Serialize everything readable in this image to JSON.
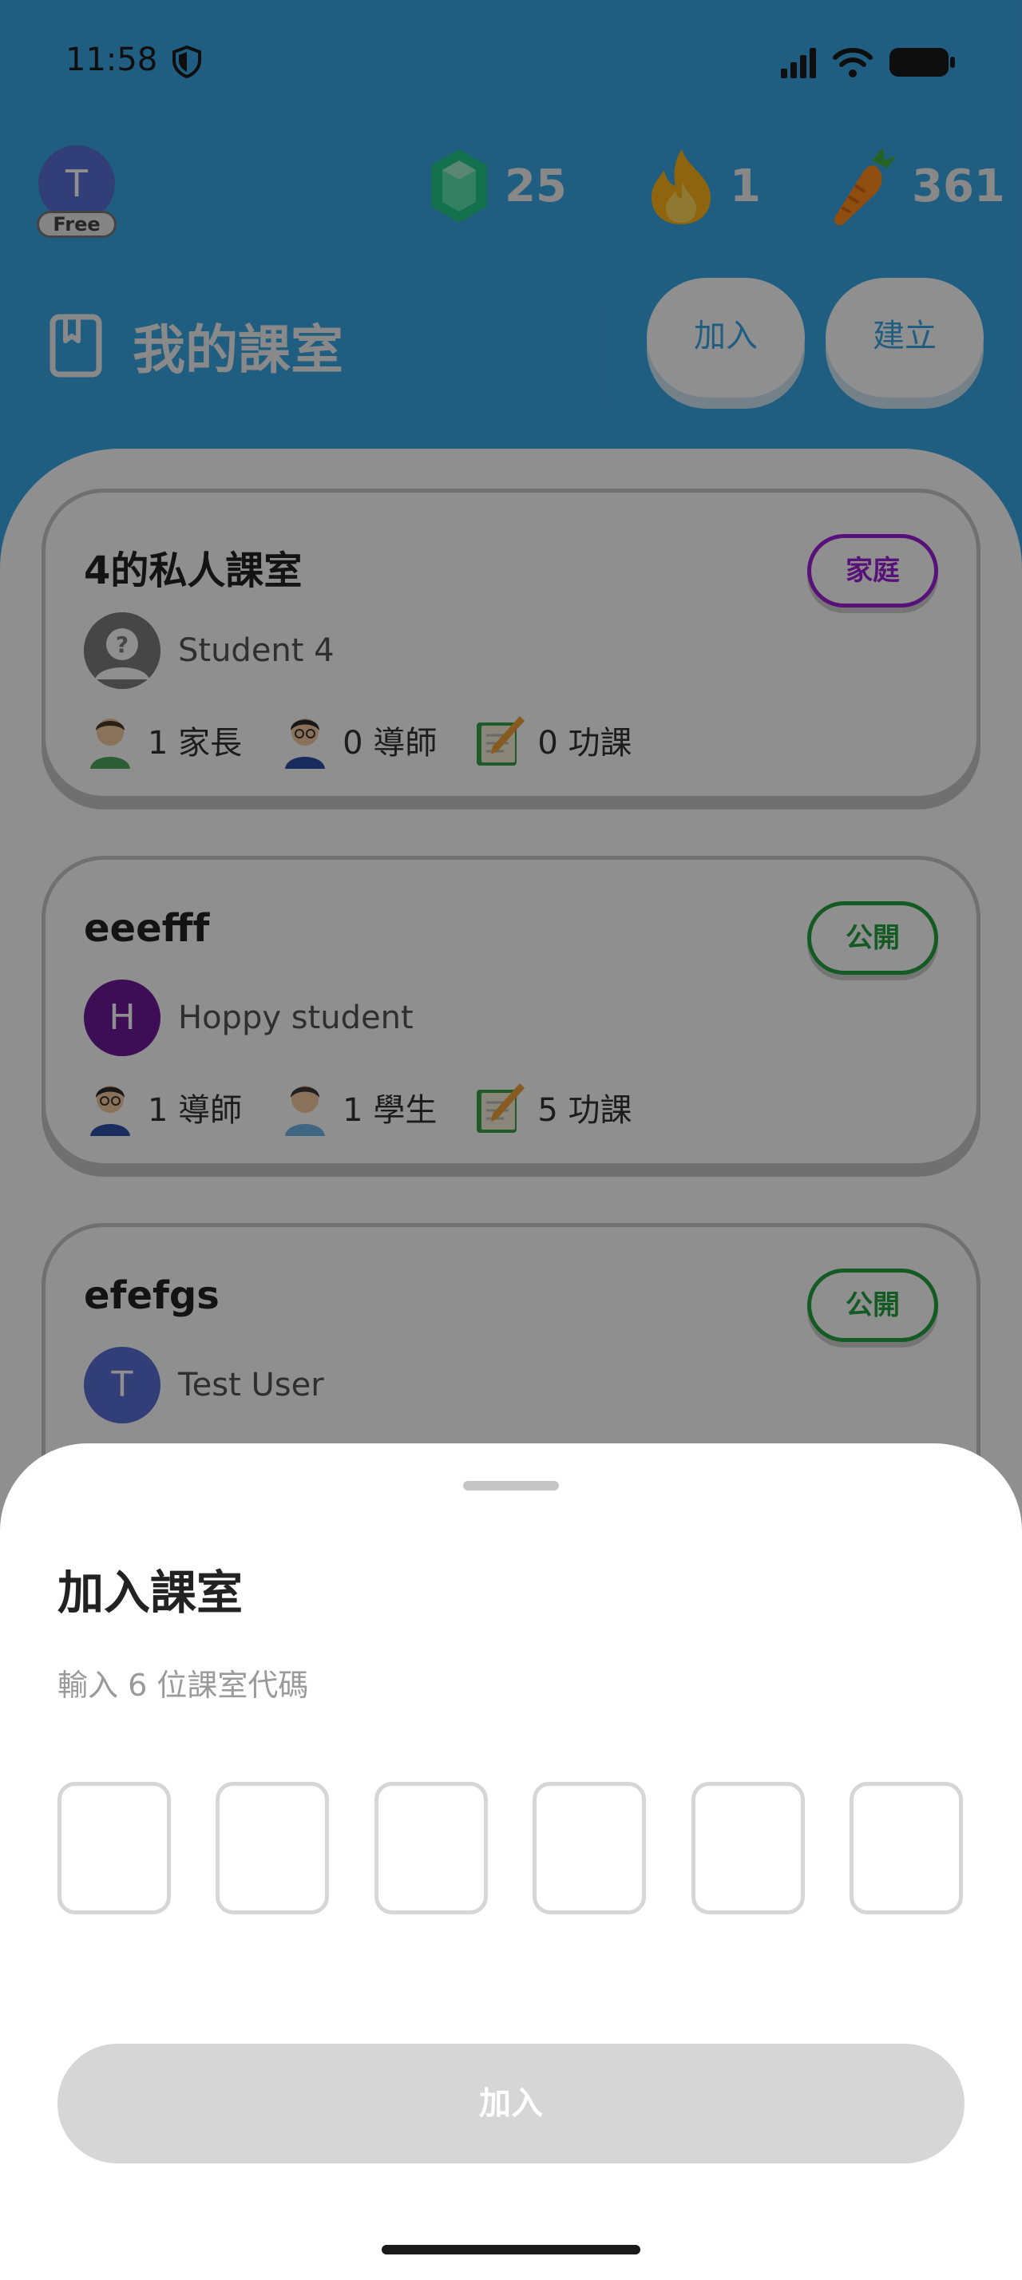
{
  "status_bar": {
    "time": "11:58"
  },
  "header": {
    "avatar_initial": "T",
    "plan_badge": "Free",
    "gems": "25",
    "streak": "1",
    "carrots": "361",
    "title": "我的課室",
    "join_label": "加入",
    "create_label": "建立"
  },
  "classrooms": [
    {
      "name": "4的私人課室",
      "tag": "家庭",
      "owner_initial": "?",
      "owner": "Student 4",
      "stats": [
        "1 家長",
        "0 導師",
        "0 功課"
      ]
    },
    {
      "name": "eeefff",
      "tag": "公開",
      "owner_initial": "H",
      "owner": "Hoppy student",
      "stats": [
        "1 導師",
        "1 學生",
        "5 功課"
      ]
    },
    {
      "name": "efefgs",
      "tag": "公開",
      "owner_initial": "T",
      "owner": "Test User"
    }
  ],
  "sheet": {
    "title": "加入課室",
    "subtitle": "輸入 6 位課室代碼",
    "code_digits": [
      "",
      "",
      "",
      "",
      "",
      ""
    ],
    "submit_label": "加入"
  },
  "colors": {
    "header_bg": "#3aa8e6",
    "family_tag": "#9b1fd6",
    "public_tag": "#23a33f",
    "avatar_purple": "#6d1a9a",
    "avatar_blue": "#5a6fd6"
  }
}
